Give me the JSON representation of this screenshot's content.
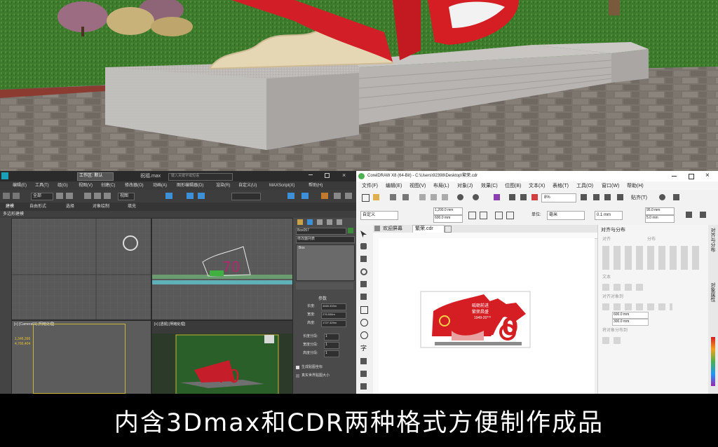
{
  "max": {
    "file_title": "祝福.max",
    "workspace": "工作区: 默认",
    "search_placeholder": "键入关键字或短语",
    "menu": [
      "编辑(E)",
      "工具(T)",
      "组(G)",
      "视图(V)",
      "创建(C)",
      "修改器(O)",
      "动画(A)",
      "图形编辑器(D)",
      "渲染(R)",
      "自定义(U)",
      "MAXScript(X)",
      "帮助(H)"
    ],
    "selection_filter": "全部",
    "view_dropdown": "视图",
    "tabs": [
      "建模",
      "自由形式",
      "选择",
      "对象绘制",
      "填充"
    ],
    "sub_label": "多边形建模",
    "viewport_labels": {
      "bottom_left": "[+] [Camera01] [明暗处理]",
      "bottom_right": "[+] [透视] [明暗处理]"
    },
    "panel": {
      "object_name": "Box057",
      "modifier_list": "修改器列表",
      "modifier": "Box",
      "params_title": "参数",
      "length_label": "长度:",
      "length_value": "4465.333m",
      "width_label": "宽度:",
      "width_value": "276.536m",
      "height_label": "高度:",
      "height_value": "1727.329m",
      "length_segs_label": "长度分段:",
      "length_segs": "1",
      "width_segs_label": "宽度分段:",
      "width_segs": "1",
      "height_segs_label": "高度分段:",
      "height_segs": "1",
      "gen_map": "生成贴图坐标",
      "real_world": "真实世界贴图大小"
    },
    "camera_readout": [
      "1,346,396",
      "4,766,404"
    ]
  },
  "cdr": {
    "title": "CorelDRAW X8 (64-Bit) - C:\\Users\\92398\\Desktop\\繁荣.cdr",
    "menu": [
      "文件(F)",
      "编辑(E)",
      "视图(V)",
      "布局(L)",
      "对象(J)",
      "效果(C)",
      "位图(B)",
      "文本(X)",
      "表格(T)",
      "工具(O)",
      "窗口(W)",
      "帮助(H)"
    ],
    "zoom": "8%",
    "snap": "贴齐(T)",
    "page_preset": "自定义",
    "width": "1,200.0 mm",
    "height": "600.0 mm",
    "unit_label": "单位:",
    "unit": "毫米",
    "nudge": "0.1 mm",
    "dup_x": "95.0 mm",
    "dup_y": "5.0 mm",
    "tabs": [
      "欢迎屏幕",
      "繁荣.cdr"
    ],
    "docker_title": "对齐与分布",
    "docker_sections": {
      "align": "对齐",
      "distribute": "分布",
      "text": "文本",
      "align_objects": "对齐对象到",
      "distribute_to": "将对象分布到"
    },
    "docker_size": [
      "600.0 mm",
      "300.0 mm"
    ],
    "side_tabs": [
      "对齐与分布",
      "对象属性"
    ],
    "design_text": [
      "砥砺前进",
      "繁荣昌盛",
      "1949-2019"
    ],
    "design_number": "70"
  },
  "caption": "内含3Dmax和CDR两种格式方便制作成品",
  "colors": {
    "red": "#d41e24",
    "grass": "#3f7a2e",
    "stone": "#b9b7b5",
    "pavement": "#77716b"
  }
}
